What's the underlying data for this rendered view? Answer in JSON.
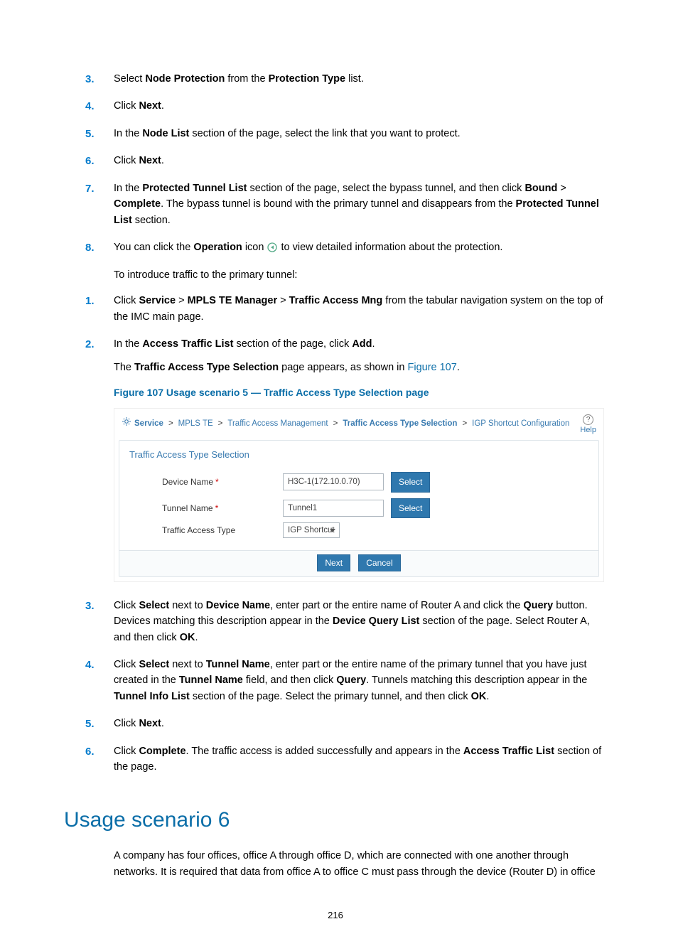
{
  "page_number": "216",
  "list_a": {
    "items": [
      {
        "num": "3.",
        "runs": [
          {
            "t": "Select "
          },
          {
            "t": "Node Protection",
            "b": true
          },
          {
            "t": " from the "
          },
          {
            "t": "Protection Type",
            "b": true
          },
          {
            "t": " list."
          }
        ]
      },
      {
        "num": "4.",
        "runs": [
          {
            "t": "Click "
          },
          {
            "t": "Next",
            "b": true
          },
          {
            "t": "."
          }
        ]
      },
      {
        "num": "5.",
        "runs": [
          {
            "t": "In the "
          },
          {
            "t": "Node List",
            "b": true
          },
          {
            "t": " section of the page, select the link that you want to protect."
          }
        ]
      },
      {
        "num": "6.",
        "runs": [
          {
            "t": "Click "
          },
          {
            "t": "Next",
            "b": true
          },
          {
            "t": "."
          }
        ]
      },
      {
        "num": "7.",
        "runs": [
          {
            "t": "In the "
          },
          {
            "t": "Protected Tunnel List",
            "b": true
          },
          {
            "t": " section of the page, select the bypass tunnel, and then click "
          },
          {
            "t": "Bound",
            "b": true
          },
          {
            "t": " > "
          },
          {
            "t": "Complete",
            "b": true
          },
          {
            "t": ". The bypass tunnel is bound with the primary tunnel and disappears from the "
          },
          {
            "t": "Protected Tunnel List",
            "b": true
          },
          {
            "t": " section."
          }
        ]
      },
      {
        "num": "8.",
        "runs": [
          {
            "t": "You can click the "
          },
          {
            "t": "Operation",
            "b": true
          },
          {
            "t": " icon "
          },
          {
            "icon": "operation"
          },
          {
            "t": "  to view detailed information about the protection."
          }
        ]
      }
    ]
  },
  "intro_line": "To introduce traffic to the primary tunnel:",
  "list_b": {
    "items": [
      {
        "num": "1.",
        "runs": [
          {
            "t": "Click "
          },
          {
            "t": "Service",
            "b": true
          },
          {
            "t": " > "
          },
          {
            "t": "MPLS TE Manager",
            "b": true
          },
          {
            "t": " > "
          },
          {
            "t": "Traffic Access Mng",
            "b": true
          },
          {
            "t": " from the tabular navigation system on the top of the IMC main page."
          }
        ]
      },
      {
        "num": "2.",
        "runs": [
          {
            "t": "In the "
          },
          {
            "t": "Access Traffic List",
            "b": true
          },
          {
            "t": " section of the page, click "
          },
          {
            "t": "Add",
            "b": true
          },
          {
            "t": "."
          }
        ],
        "sub_runs": [
          {
            "t": "The "
          },
          {
            "t": "Traffic Access Type Selection",
            "b": true
          },
          {
            "t": " page appears, as shown in "
          },
          {
            "t": "Figure 107",
            "link": true
          },
          {
            "t": "."
          }
        ]
      }
    ]
  },
  "figure": {
    "caption": "Figure 107 Usage scenario 5 — Traffic Access Type Selection page",
    "breadcrumb": {
      "service": "Service",
      "parts": [
        "MPLS TE",
        "Traffic Access Management"
      ],
      "current": "Traffic Access Type Selection",
      "last": "IGP Shortcut Configuration"
    },
    "help": "Help",
    "panel_title": "Traffic Access Type Selection",
    "device_label": "Device Name",
    "device_value": "H3C-1(172.10.0.70)",
    "tunnel_label": "Tunnel Name",
    "tunnel_value": "Tunnel1",
    "type_label": "Traffic Access Type",
    "type_value": "IGP Shortcut",
    "select_btn": "Select",
    "next_btn": "Next",
    "cancel_btn": "Cancel"
  },
  "list_c": {
    "items": [
      {
        "num": "3.",
        "runs": [
          {
            "t": "Click "
          },
          {
            "t": "Select",
            "b": true
          },
          {
            "t": " next to "
          },
          {
            "t": "Device Name",
            "b": true
          },
          {
            "t": ", enter part or the entire name of Router A and click the "
          },
          {
            "t": "Query",
            "b": true
          },
          {
            "t": " button. Devices matching this description appear in the "
          },
          {
            "t": "Device Query List",
            "b": true
          },
          {
            "t": " section of the page. Select Router A, and then click "
          },
          {
            "t": "OK",
            "b": true
          },
          {
            "t": "."
          }
        ]
      },
      {
        "num": "4.",
        "runs": [
          {
            "t": "Click "
          },
          {
            "t": "Select",
            "b": true
          },
          {
            "t": " next to "
          },
          {
            "t": "Tunnel Name",
            "b": true
          },
          {
            "t": ", enter part or the entire name of the primary tunnel that you have just created in the "
          },
          {
            "t": "Tunnel Name",
            "b": true
          },
          {
            "t": " field, and then click "
          },
          {
            "t": "Query",
            "b": true
          },
          {
            "t": ". Tunnels matching this description appear in the "
          },
          {
            "t": "Tunnel Info List",
            "b": true
          },
          {
            "t": " section of the page. Select the primary tunnel, and then click "
          },
          {
            "t": "OK",
            "b": true
          },
          {
            "t": "."
          }
        ]
      },
      {
        "num": "5.",
        "runs": [
          {
            "t": "Click "
          },
          {
            "t": "Next",
            "b": true
          },
          {
            "t": "."
          }
        ]
      },
      {
        "num": "6.",
        "runs": [
          {
            "t": "Click "
          },
          {
            "t": "Complete",
            "b": true
          },
          {
            "t": ". The traffic access is added successfully and appears in the "
          },
          {
            "t": "Access Traffic List",
            "b": true
          },
          {
            "t": " section of the page."
          }
        ]
      }
    ]
  },
  "h2": "Usage scenario 6",
  "scenario6_para": "A company has four offices, office A through office D, which are connected with one another through networks. It is required that data from office A to office C must pass through the device (Router D) in office"
}
